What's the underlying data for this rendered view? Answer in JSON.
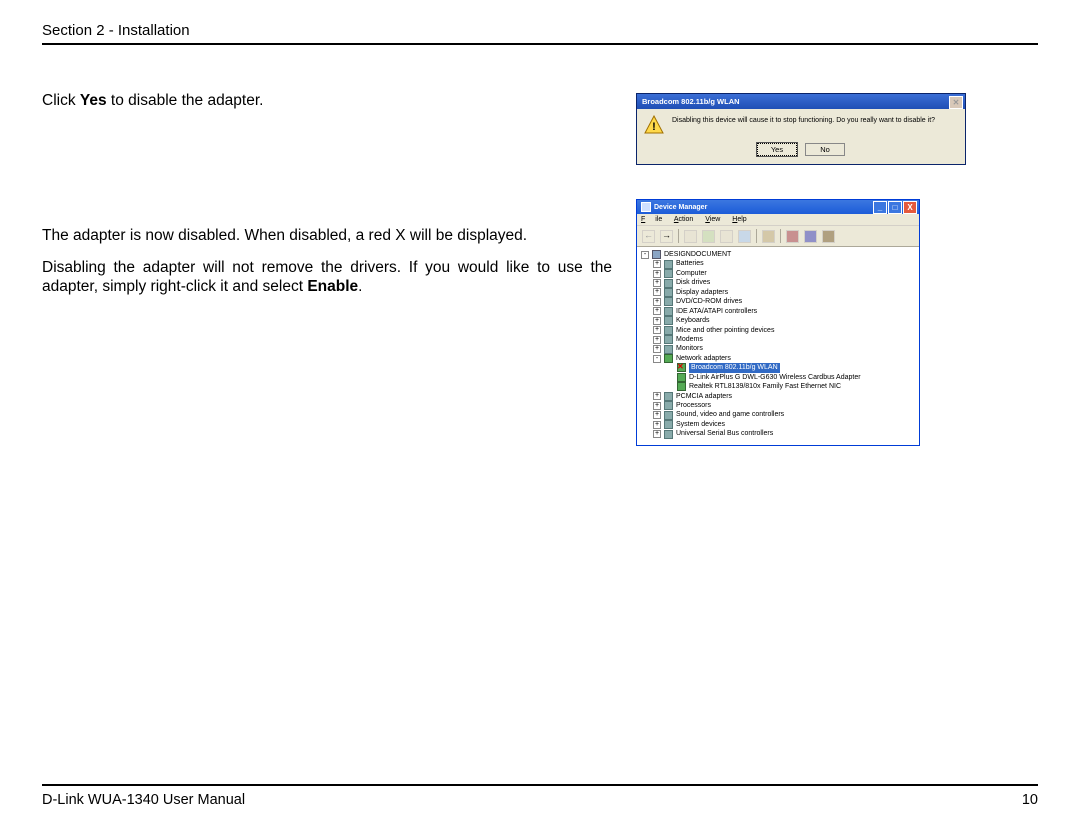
{
  "header": {
    "section_label": "Section 2 - Installation"
  },
  "body": {
    "p1_pre": "Click ",
    "p1_bold": "Yes",
    "p1_post": " to disable the adapter.",
    "p2": "The adapter is now disabled. When disabled, a red X will be displayed.",
    "p3_pre": "Disabling the adapter will not remove the drivers. If you would like to use the adapter, simply right-click it and select ",
    "p3_bold": "Enable",
    "p3_post": "."
  },
  "dialog": {
    "title": "Broadcom 802.11b/g WLAN",
    "message": "Disabling this device will cause it to stop functioning. Do you really want to disable it?",
    "yes": "Yes",
    "no": "No"
  },
  "devmgr": {
    "title": "Device Manager",
    "menu": {
      "file": "File",
      "action": "Action",
      "view": "View",
      "help": "Help"
    },
    "root": "DESIGNDOCUMENT",
    "nodes": {
      "batteries": "Batteries",
      "computer": "Computer",
      "disk": "Disk drives",
      "display": "Display adapters",
      "dvd": "DVD/CD-ROM drives",
      "ide": "IDE ATA/ATAPI controllers",
      "keyboards": "Keyboards",
      "mice": "Mice and other pointing devices",
      "modems": "Modems",
      "monitors": "Monitors",
      "network": "Network adapters",
      "broadcom": "Broadcom 802.11b/g WLAN",
      "dlink": "D-Link AirPlus G DWL-G630 Wireless Cardbus Adapter",
      "realtek": "Realtek RTL8139/810x Family Fast Ethernet NIC",
      "pcmcia": "PCMCIA adapters",
      "processors": "Processors",
      "sound": "Sound, video and game controllers",
      "system": "System devices",
      "usb": "Universal Serial Bus controllers"
    }
  },
  "footer": {
    "manual": "D-Link WUA-1340 User Manual",
    "page": "10"
  }
}
